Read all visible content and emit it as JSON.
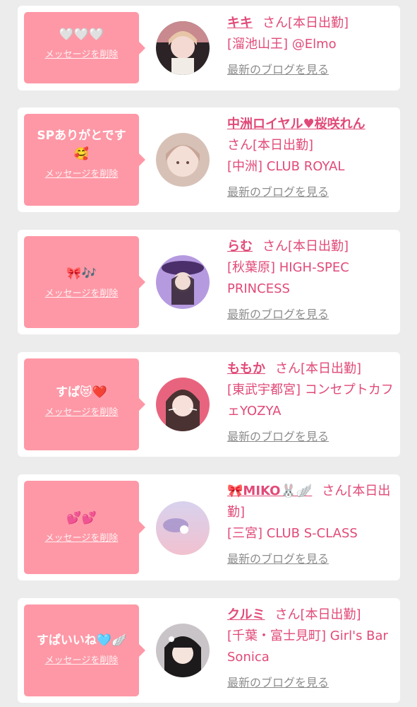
{
  "colors": {
    "accent": "#e14a78",
    "bubble": "#fe98a6",
    "background": "#ececec"
  },
  "cards": [
    {
      "message": "🤍🤍🤍",
      "delete_label": "メッセージを削除",
      "name": "キキ",
      "san_status": "さん[本日出勤]",
      "shop": "[溜池山王] @Elmo",
      "blog_label": "最新のブログを見る"
    },
    {
      "message": "SPありがとです🥰",
      "delete_label": "メッセージを削除",
      "name": "中洲ロイヤル♥桜咲れん",
      "san_status": "さん[本日出勤]",
      "shop": "[中洲] CLUB ROYAL",
      "blog_label": "最新のブログを見る"
    },
    {
      "message": "🎀🎶",
      "delete_label": "メッセージを削除",
      "name": "らむ",
      "san_status": "さん[本日出勤]",
      "shop": "[秋葉原] HIGH-SPEC PRINCESS",
      "blog_label": "最新のブログを見る"
    },
    {
      "message": "すぱ😻❤️",
      "delete_label": "メッセージを削除",
      "name": "ももか",
      "san_status": "さん[本日出勤]",
      "shop": "[東武宇都宮] コンセプトカフェYOZYA",
      "blog_label": "最新のブログを見る"
    },
    {
      "message": "💕💕",
      "delete_label": "メッセージを削除",
      "name": "🎀MIKO🐰🪽",
      "san_status": "さん[本日出勤]",
      "shop": "[三宮] CLUB S-CLASS",
      "blog_label": "最新のブログを見る"
    },
    {
      "message": "すぱいいね🩵🪽",
      "delete_label": "メッセージを削除",
      "name": "クルミ",
      "san_status": "さん[本日出勤]",
      "shop": "[千葉・富士見町] Girl's Bar Sonica",
      "blog_label": "最新のブログを見る"
    }
  ]
}
